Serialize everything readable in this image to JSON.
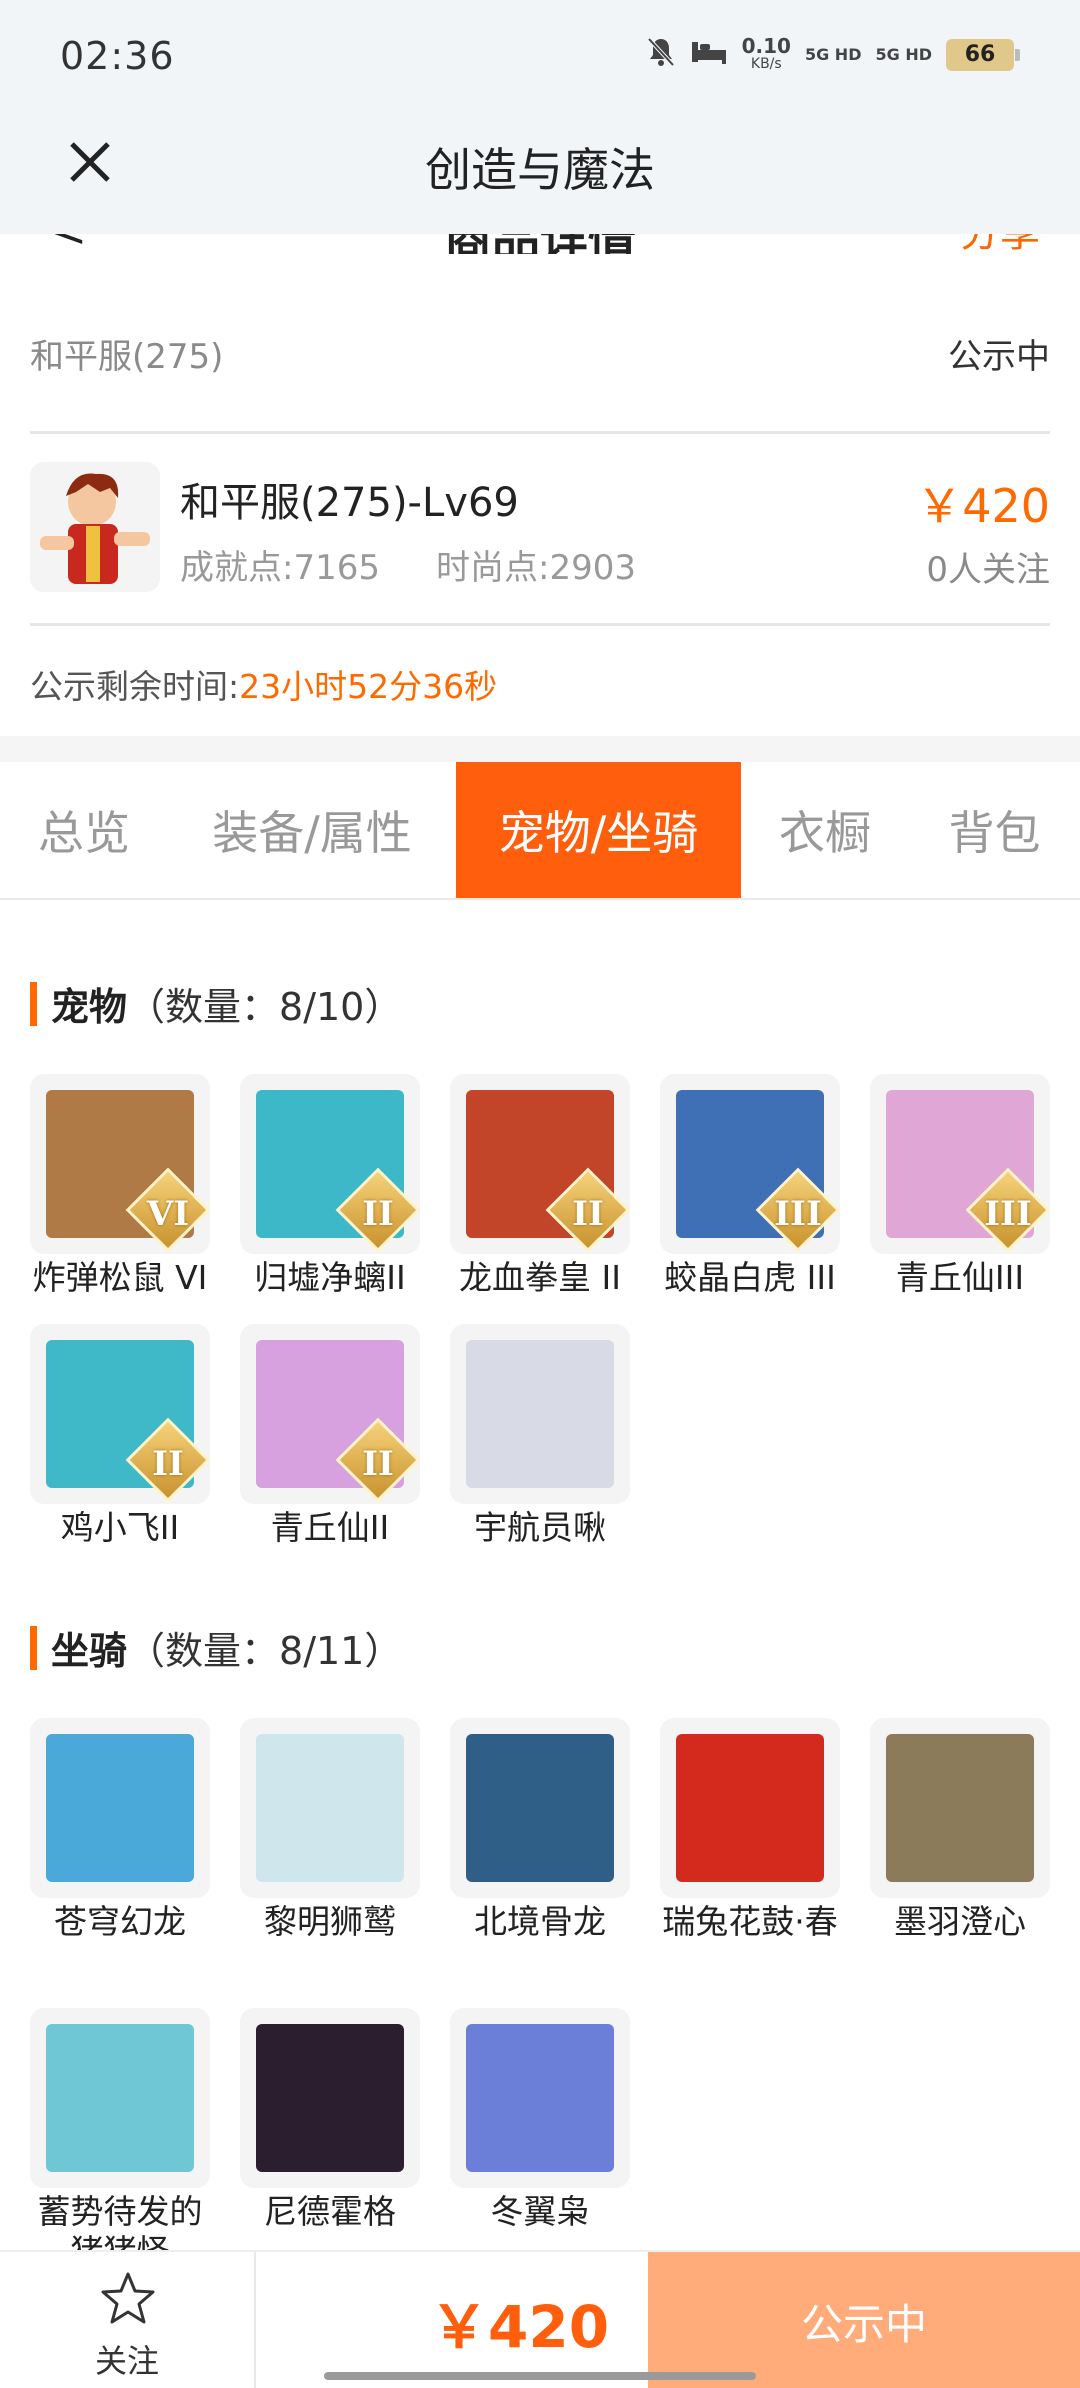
{
  "status_bar": {
    "time": "02:36",
    "speed_value": "0.10",
    "speed_unit": "KB/s",
    "net1": "5G HD",
    "net2": "5G HD",
    "battery": "66"
  },
  "app_bar": {
    "title": "创造与魔法"
  },
  "hidden_header": {
    "title": "商品详情",
    "share": "分享"
  },
  "server": {
    "name": "和平服(275)",
    "status": "公示中"
  },
  "character": {
    "name": "和平服(275)-Lv69",
    "achievement": "成就点:7165",
    "fashion": "时尚点:2903",
    "price": "￥420",
    "followers": "0人关注"
  },
  "timer": {
    "label": "公示剩余时间:",
    "value": "23小时52分36秒"
  },
  "tabs": [
    {
      "label": "总览"
    },
    {
      "label": "装备/属性"
    },
    {
      "label": "宠物/坐骑"
    },
    {
      "label": "衣橱"
    },
    {
      "label": "背包"
    }
  ],
  "pets": {
    "title": "宠物",
    "count": "（数量：8/10）",
    "items": [
      {
        "name": "炸弹松鼠 VI",
        "tier": "VI",
        "color": "#b07a46"
      },
      {
        "name": "归墟净螭II",
        "tier": "II",
        "color": "#3db8c8"
      },
      {
        "name": "龙血拳皇 II",
        "tier": "II",
        "color": "#c2452a"
      },
      {
        "name": "蛟晶白虎 III",
        "tier": "III",
        "color": "#3f6fb5"
      },
      {
        "name": "青丘仙III",
        "tier": "III",
        "color": "#e0a6d6"
      },
      {
        "name": "鸡小飞II",
        "tier": "II",
        "color": "#3fb8c7"
      },
      {
        "name": "青丘仙II",
        "tier": "II",
        "color": "#d7a0de"
      },
      {
        "name": "宇航员啾",
        "tier": "",
        "color": "#d8dbe6"
      }
    ]
  },
  "mounts": {
    "title": "坐骑",
    "count": "（数量：8/11）",
    "items": [
      {
        "name": "苍穹幻龙",
        "color": "#4aa9d8"
      },
      {
        "name": "黎明狮鹫",
        "color": "#cfe6ec"
      },
      {
        "name": "北境骨龙",
        "color": "#2f5f86"
      },
      {
        "name": "瑞兔花鼓·春",
        "color": "#d42a1e"
      },
      {
        "name": "墨羽澄心",
        "color": "#8c7b5a"
      },
      {
        "name": "蓄势待发的猪猪怪",
        "color": "#6fc7d6"
      },
      {
        "name": "尼德霍格",
        "color": "#2b1e2e"
      },
      {
        "name": "冬翼枭",
        "color": "#6b7fd8"
      }
    ]
  },
  "bottom_bar": {
    "follow_label": "关注",
    "price": "￥420",
    "action_label": "公示中"
  }
}
